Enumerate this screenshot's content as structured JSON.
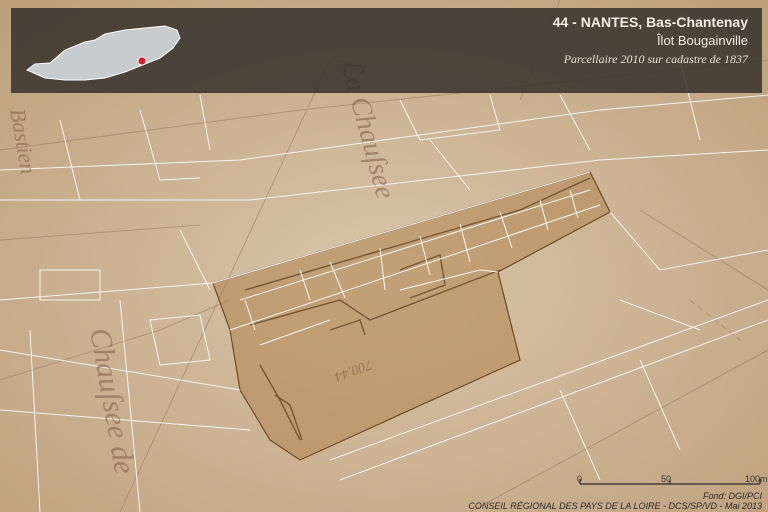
{
  "banner": {
    "title": "44 - NANTES, Bas-Chantenay",
    "subtitle": "Îlot Bougainville",
    "caption": "Parcellaire 2010 sur cadastre de 1837"
  },
  "scale": {
    "labels": [
      "0",
      "50",
      "100m"
    ]
  },
  "credits": {
    "source": "Fond: DGI/PCI",
    "author": "CONSEIL RÉGIONAL DES PAYS DE LA LOIRE - DCS/SP/VD - Mai 2013"
  },
  "colors": {
    "paper": "#cdb596",
    "parcel_highlight": "#b08350",
    "banner_bg": "#3a342e",
    "location_dot": "#d0202a",
    "outline": "#ffffff"
  }
}
